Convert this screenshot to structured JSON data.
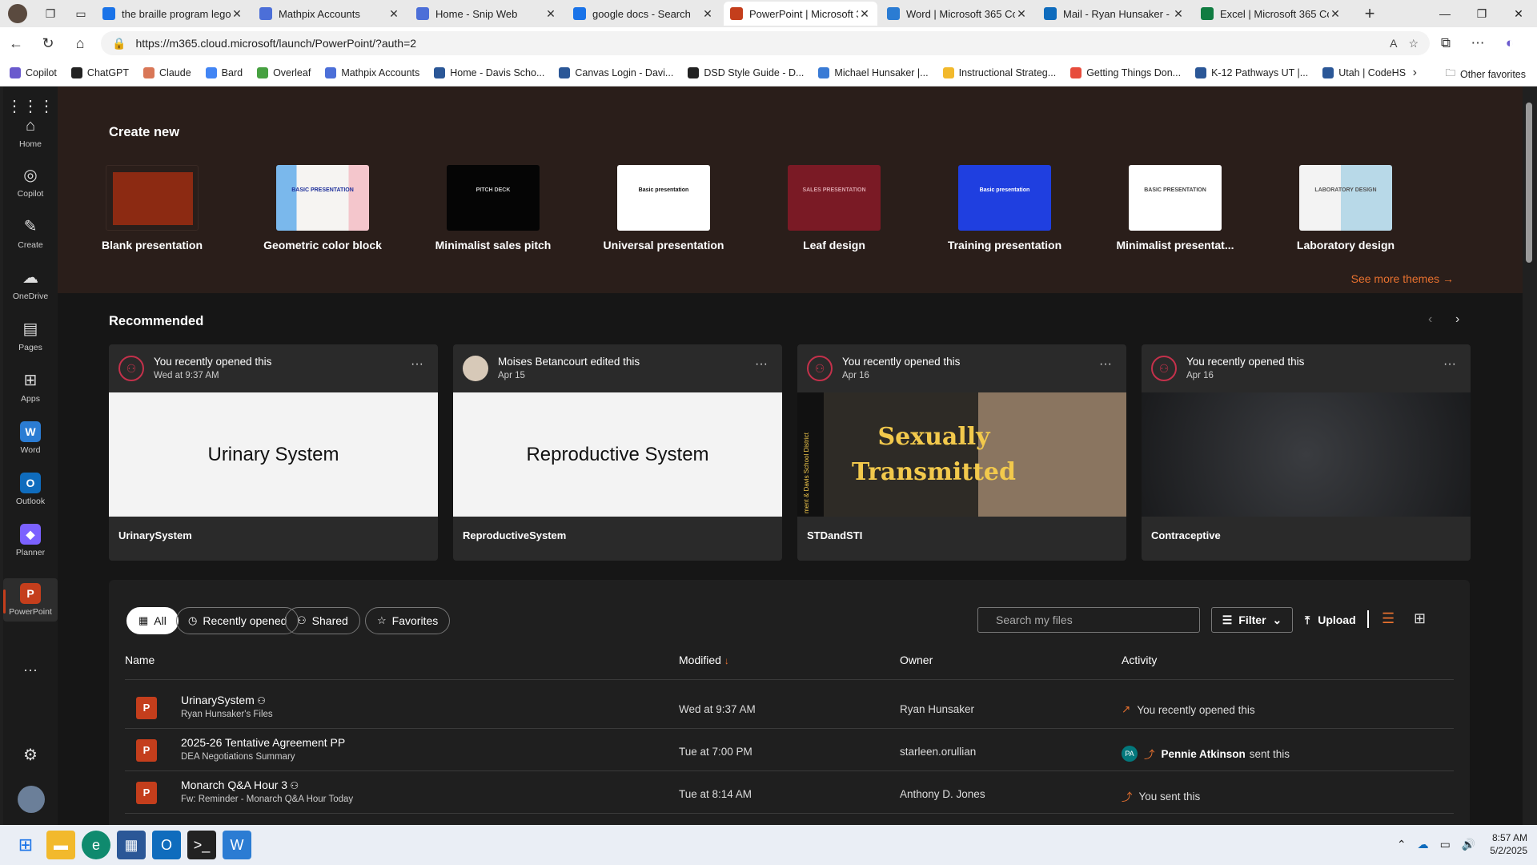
{
  "browser": {
    "tabs": [
      {
        "title": "the braille program lego",
        "color": "#1a73e8"
      },
      {
        "title": "Mathpix Accounts",
        "color": "#4c6fd8"
      },
      {
        "title": "Home - Snip Web",
        "color": "#4c6fd8"
      },
      {
        "title": "google docs - Search",
        "color": "#1a73e8"
      },
      {
        "title": "PowerPoint | Microsoft 36",
        "color": "#c43e1c",
        "active": true
      },
      {
        "title": "Word | Microsoft 365 Cop",
        "color": "#2b7cd3"
      },
      {
        "title": "Mail - Ryan Hunsaker - O",
        "color": "#0f6cbd"
      },
      {
        "title": "Excel | Microsoft 365 Cop",
        "color": "#107c41"
      }
    ],
    "url": "https://m365.cloud.microsoft/launch/PowerPoint/?auth=2",
    "bookmarks": [
      "Copilot",
      "ChatGPT",
      "Claude",
      "Bard",
      "Overleaf",
      "Mathpix Accounts",
      "Home - Davis Scho...",
      "Canvas Login - Davi...",
      "DSD Style Guide - D...",
      "Michael Hunsaker |...",
      "Instructional Strateg...",
      "Getting Things Don...",
      "K-12 Pathways UT |...",
      "Utah | CodeHS"
    ],
    "other_favorites": "Other favorites"
  },
  "rail": [
    {
      "label": "Home",
      "icon": "home-icon",
      "glyph": "⌂"
    },
    {
      "label": "Copilot",
      "icon": "copilot-icon",
      "glyph": "◎"
    },
    {
      "label": "Create",
      "icon": "pen-icon",
      "glyph": "✎"
    },
    {
      "label": "OneDrive",
      "icon": "cloud-icon",
      "glyph": "☁"
    },
    {
      "label": "Pages",
      "icon": "pages-icon",
      "glyph": "▤"
    },
    {
      "label": "Apps",
      "icon": "apps-icon",
      "glyph": "⊞"
    },
    {
      "label": "Word",
      "icon": "word-icon",
      "glyph": "W"
    },
    {
      "label": "Outlook",
      "icon": "outlook-icon",
      "glyph": "O"
    },
    {
      "label": "Planner",
      "icon": "planner-icon",
      "glyph": "◆"
    },
    {
      "label": "PowerPoint",
      "icon": "powerpoint-icon",
      "glyph": "P"
    }
  ],
  "create": {
    "title": "Create new",
    "templates": [
      "Blank presentation",
      "Geometric color block",
      "Minimalist sales pitch",
      "Universal presentation",
      "Leaf design",
      "Training presentation",
      "Minimalist presentat...",
      "Laboratory design"
    ],
    "thumb_texts": [
      "",
      "BASIC PRESENTATION",
      "PITCH DECK",
      "Basic presentation",
      "SALES PRESENTATION",
      "Basic presentation",
      "BASIC PRESENTATION",
      "LABORATORY DESIGN"
    ],
    "see_more": "See more themes"
  },
  "recommended": {
    "title": "Recommended",
    "cards": [
      {
        "who": "You recently opened this",
        "when": "Wed at 9:37 AM",
        "preview": "Urinary System",
        "file": "UrinarySystem"
      },
      {
        "who": "Moises Betancourt edited this",
        "when": "Apr 15",
        "preview": "Reproductive System",
        "file": "ReproductiveSystem"
      },
      {
        "who": "You recently opened this",
        "when": "Apr 16",
        "preview": "Sexually Transmitted",
        "preview_side": "ment & Davis School District",
        "file": "STDandSTI"
      },
      {
        "who": "You recently opened this",
        "when": "Apr 16",
        "preview": "",
        "file": "Contraceptive"
      }
    ]
  },
  "files": {
    "pills": [
      "All",
      "Recently opened",
      "Shared",
      "Favorites"
    ],
    "search_placeholder": "Search my files",
    "filter": "Filter",
    "upload": "Upload",
    "columns": [
      "Name",
      "Modified",
      "Owner",
      "Activity"
    ],
    "rows": [
      {
        "name": "UrinarySystem",
        "sub": "Ryan Hunsaker's Files",
        "modified": "Wed at 9:37 AM",
        "owner": "Ryan Hunsaker",
        "activity": "You recently opened this"
      },
      {
        "name": "2025-26 Tentative Agreement PP",
        "sub": "DEA Negotiations Summary",
        "modified": "Tue at 7:00 PM",
        "owner": "starleen.orullian",
        "activity_person": "Pennie Atkinson",
        "activity": "sent this",
        "initials": "PA"
      },
      {
        "name": "Monarch Q&A Hour 3",
        "sub": "Fw: Reminder - Monarch Q&A Hour Today",
        "modified": "Tue at 8:14 AM",
        "owner": "Anthony D. Jones",
        "activity": "You sent this"
      }
    ]
  },
  "taskbar": {
    "time": "8:57 AM",
    "date": "5/2/2025"
  }
}
